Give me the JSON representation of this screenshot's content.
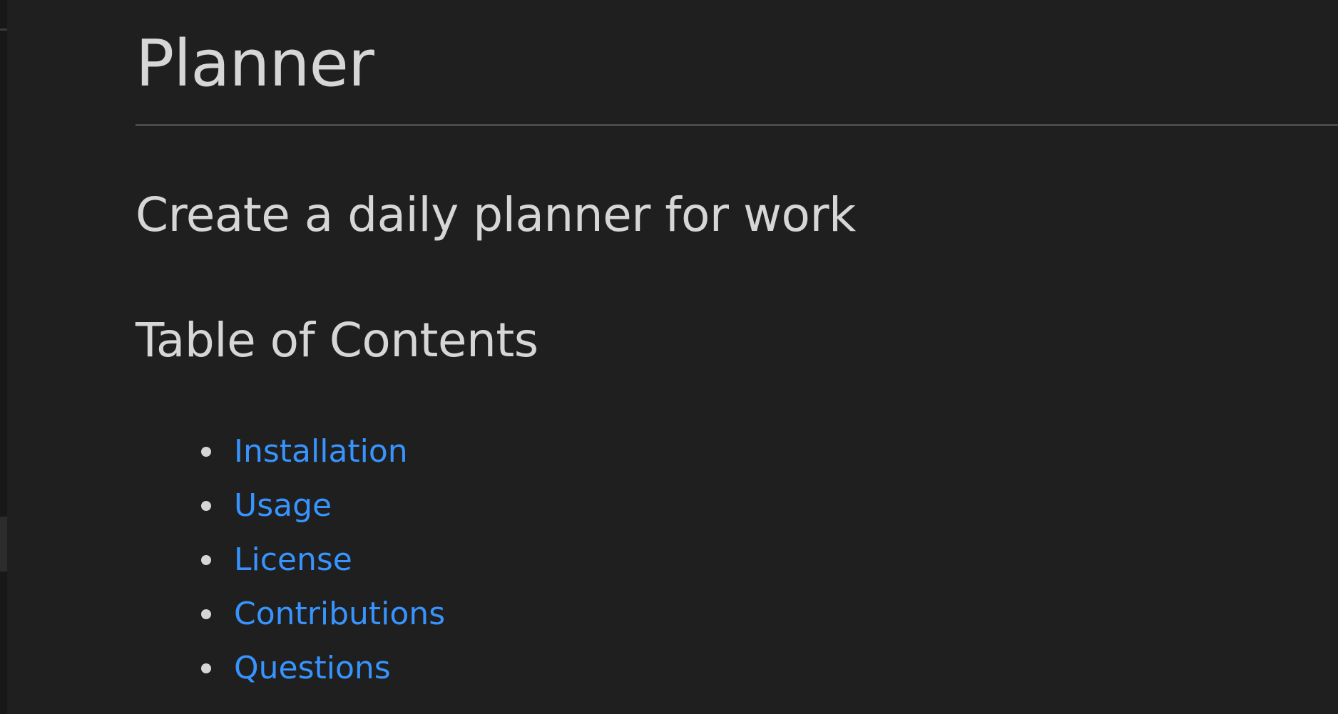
{
  "document": {
    "title": "Planner",
    "description": "Create a daily planner for work",
    "toc_heading": "Table of Contents",
    "toc_items": [
      {
        "label": "Installation",
        "icon": "bullet-icon"
      },
      {
        "label": "Usage",
        "icon": "bullet-icon"
      },
      {
        "label": "License",
        "icon": "bullet-icon"
      },
      {
        "label": "Contributions",
        "icon": "bullet-icon"
      },
      {
        "label": "Questions",
        "icon": "bullet-icon"
      }
    ]
  },
  "colors": {
    "background": "#1f1f1f",
    "text": "#d6d6d6",
    "link": "#3794ff",
    "rule": "#4a4a4a"
  }
}
